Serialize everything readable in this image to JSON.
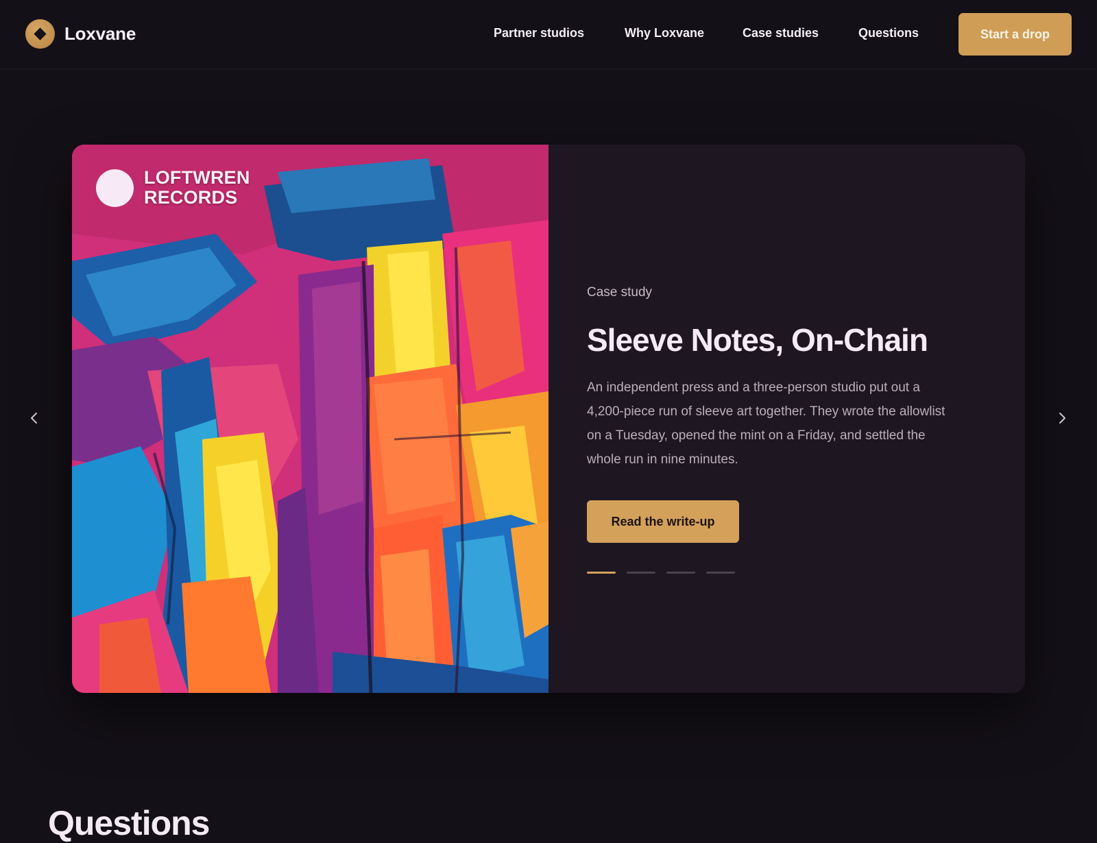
{
  "brand": {
    "name": "Loxvane",
    "icon": "diamond-logo-icon"
  },
  "nav": {
    "items": [
      {
        "label": "Partner studios"
      },
      {
        "label": "Why Loxvane"
      },
      {
        "label": "Case studies"
      },
      {
        "label": "Questions"
      }
    ],
    "cta_label": "Start a drop"
  },
  "slide": {
    "label_line1": "LOFTWREN",
    "label_line2": "RECORDS",
    "eyebrow": "Case study",
    "title": "Sleeve Notes, On-Chain",
    "body": "An independent press and a three-person studio put out a 4,200-piece run of sleeve art together. They wrote the allowlist on a Tuesday, opened the mint on a Friday, and settled the whole run in nine minutes.",
    "button_label": "Read the write-up",
    "dots_total": 4,
    "active_index": 0
  },
  "carousel": {
    "prev_icon": "chevron-left-icon",
    "next_icon": "chevron-right-icon"
  },
  "next_section": {
    "title": "Questions"
  },
  "colors": {
    "accent": "#d4a15b",
    "background": "#141017",
    "card": "#1e1722"
  }
}
